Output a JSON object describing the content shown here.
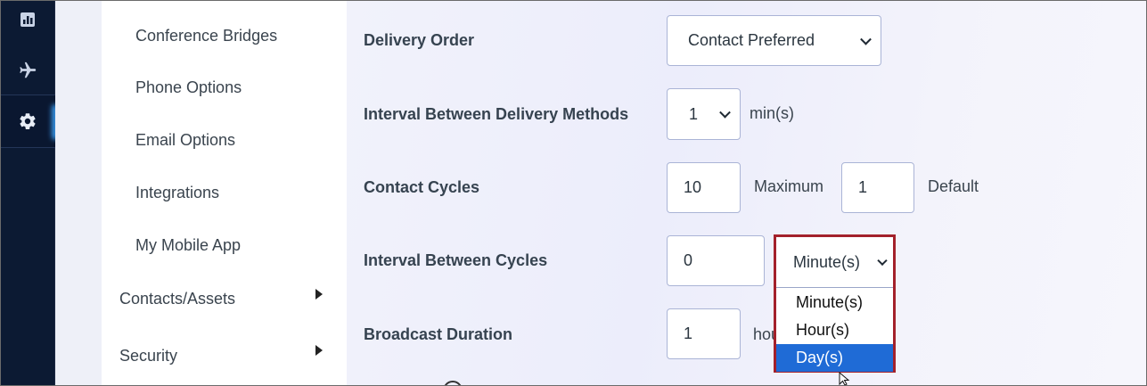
{
  "rail": {
    "items": [
      {
        "icon": "dashboard-icon"
      },
      {
        "icon": "airplane-icon"
      },
      {
        "icon": "gear-icon",
        "active": true
      }
    ]
  },
  "subnav": {
    "items": [
      {
        "label": "Conference Bridges"
      },
      {
        "label": "Phone Options"
      },
      {
        "label": "Email Options"
      },
      {
        "label": "Integrations"
      },
      {
        "label": "My Mobile App"
      },
      {
        "label": "Contacts/Assets"
      },
      {
        "label": "Security"
      }
    ]
  },
  "form": {
    "delivery_order": {
      "label": "Delivery Order",
      "value": "Contact Preferred"
    },
    "interval_methods": {
      "label": "Interval Between Delivery Methods",
      "value": "1",
      "unit": "min(s)"
    },
    "contact_cycles": {
      "label": "Contact Cycles",
      "max_value": "10",
      "max_label": "Maximum",
      "default_value": "1",
      "default_label": "Default"
    },
    "interval_cycles": {
      "label": "Interval Between Cycles",
      "value": "0",
      "unit_selected": "Minute(s)",
      "options": [
        "Minute(s)",
        "Hour(s)",
        "Day(s)"
      ],
      "highlighted": "Day(s)"
    },
    "broadcast_duration": {
      "label": "Broadcast Duration",
      "value": "1",
      "unit": "hou"
    }
  },
  "colors": {
    "rail_bg": "#0c1a33",
    "highlight_border": "#a3212b",
    "option_selected": "#1f6bd6"
  }
}
